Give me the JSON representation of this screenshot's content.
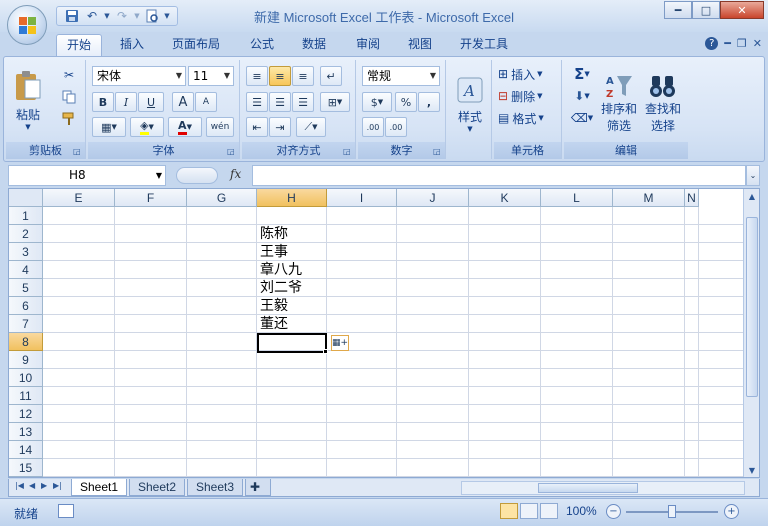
{
  "window": {
    "title": "新建 Microsoft Excel 工作表 - Microsoft Excel",
    "controls": [
      "minimize",
      "maximize",
      "close"
    ]
  },
  "qat": {
    "icons": [
      "save-icon",
      "undo-icon",
      "redo-icon",
      "print-preview-icon",
      "customize-arrow-icon"
    ]
  },
  "tabs": [
    "开始",
    "插入",
    "页面布局",
    "公式",
    "数据",
    "审阅",
    "视图",
    "开发工具"
  ],
  "active_tab": "开始",
  "ribbon": {
    "clipboard": {
      "label": "剪贴板",
      "paste": "粘贴"
    },
    "font": {
      "label": "字体",
      "font_name": "宋体",
      "font_size": "11",
      "bold": "B",
      "italic": "I",
      "underline": "U",
      "grow": "A",
      "shrink": "A",
      "phonetic": "wén"
    },
    "alignment": {
      "label": "对齐方式"
    },
    "number": {
      "label": "数字",
      "format": "常规",
      "percent": "%",
      "comma": ",",
      "inc_decimal": ".00",
      "dec_decimal": ".00"
    },
    "styles": {
      "label": "样式"
    },
    "cells": {
      "label": "单元格",
      "insert": "插入",
      "delete": "删除",
      "format": "格式"
    },
    "editing": {
      "label": "编辑",
      "sum": "Σ",
      "sort_filter": "排序和\n筛选",
      "sort_l1": "排序和",
      "sort_l2": "筛选",
      "find_l1": "查找和",
      "find_l2": "选择"
    }
  },
  "formula_bar": {
    "name_box": "H8",
    "fx": "fx",
    "formula": ""
  },
  "grid": {
    "columns": [
      "E",
      "F",
      "G",
      "H",
      "I",
      "J",
      "K",
      "L",
      "M",
      "N"
    ],
    "rows": [
      "1",
      "2",
      "3",
      "4",
      "5",
      "6",
      "7",
      "8",
      "9",
      "10",
      "11",
      "12",
      "13",
      "14",
      "15"
    ],
    "selected_column": "H",
    "selected_row": "8",
    "cells": {
      "H2": "陈称",
      "H3": "王事",
      "H4": "章八九",
      "H5": "刘二爷",
      "H6": "王毅",
      "H7": "董还"
    }
  },
  "sheets": [
    "Sheet1",
    "Sheet2",
    "Sheet3"
  ],
  "active_sheet": "Sheet1",
  "status": {
    "ready": "就绪",
    "zoom": "100%"
  },
  "colors": {
    "ribbon_bg": "#d6e3f5",
    "selected_header": "#f1c15f",
    "grid_line": "#d0d7e5"
  }
}
